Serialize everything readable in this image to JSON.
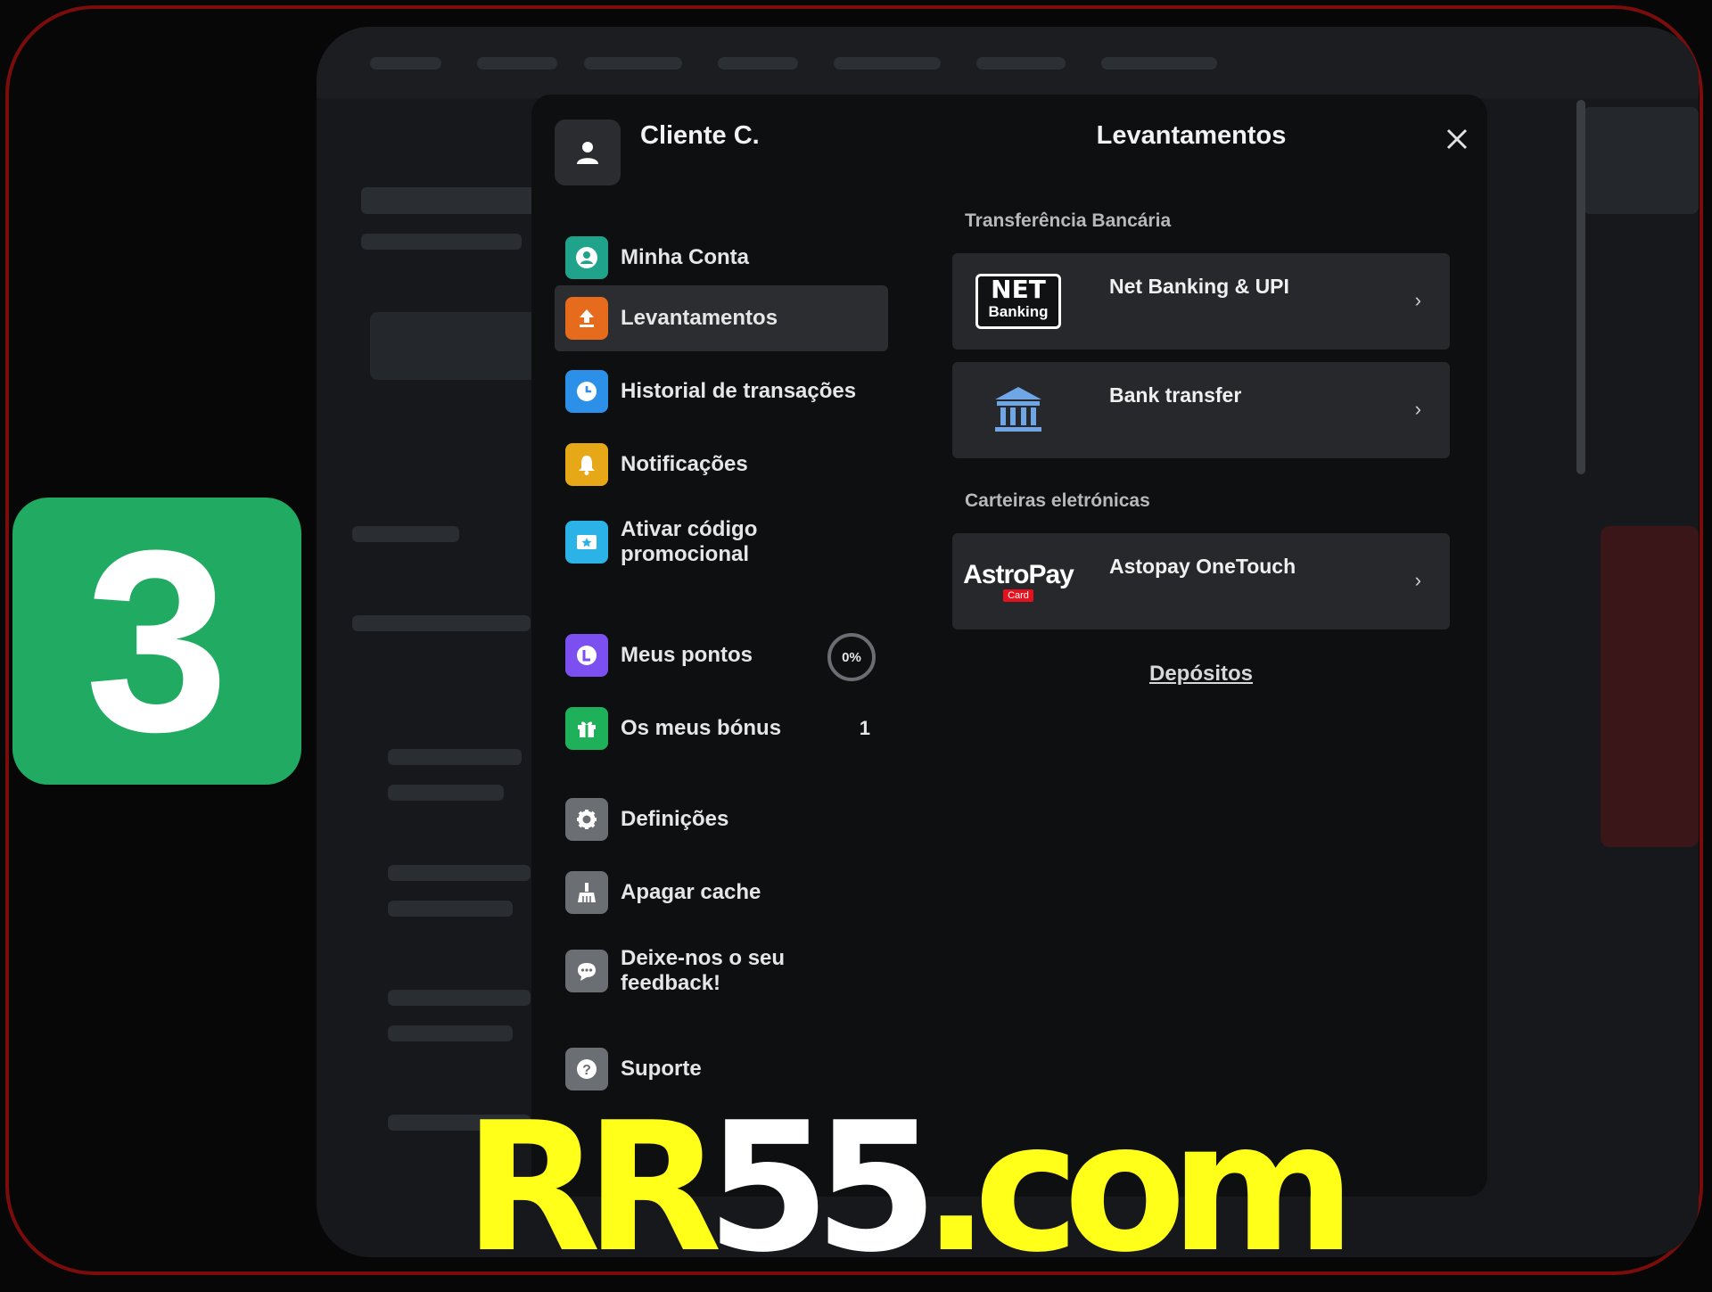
{
  "step_number": "3",
  "profile": {
    "name": "Cliente C."
  },
  "panel": {
    "title": "Levantamentos"
  },
  "menu": [
    {
      "label": "Minha Conta",
      "icon": "account-icon",
      "color": "#1fa38a"
    },
    {
      "label": "Levantamentos",
      "icon": "withdraw-icon",
      "color": "#e66b1c",
      "active": true
    },
    {
      "label": "Historial de transações",
      "icon": "clock-icon",
      "color": "#2c8fe8"
    },
    {
      "label": "Notificações",
      "icon": "bell-icon",
      "color": "#e6a817"
    },
    {
      "label": "Ativar código promocional",
      "icon": "ticket-icon",
      "color": "#2bb3e8"
    },
    {
      "label": "Meus pontos",
      "icon": "loyalty-icon",
      "color": "#7b4ff0",
      "extra": "0%"
    },
    {
      "label": "Os meus bónus",
      "icon": "gift-icon",
      "color": "#1fb05a",
      "extra": "1"
    },
    {
      "label": "Definições",
      "icon": "gear-icon",
      "color": "#6b6e73"
    },
    {
      "label": "Apagar cache",
      "icon": "broom-icon",
      "color": "#6b6e73"
    },
    {
      "label": "Deixe-nos o seu feedback!",
      "icon": "chat-icon",
      "color": "#6b6e73"
    },
    {
      "label": "Suporte",
      "icon": "help-icon",
      "color": "#6b6e73"
    }
  ],
  "sections": {
    "bank": "Transferência Bancária",
    "wallets": "Carteiras eletrónicas"
  },
  "methods": {
    "netbanking": {
      "name": "Net Banking & UPI",
      "logo_top": "NET",
      "logo_bottom": "Banking"
    },
    "bank": {
      "name": "Bank transfer",
      "icon": "bank-icon"
    },
    "astropay": {
      "name": "Astopay OneTouch",
      "logo": "AstroPay",
      "logo_sub": "Card"
    }
  },
  "deposits_link": "Depósitos",
  "watermark": {
    "part1": "RR",
    "part2": "55",
    "part3": ".com"
  }
}
